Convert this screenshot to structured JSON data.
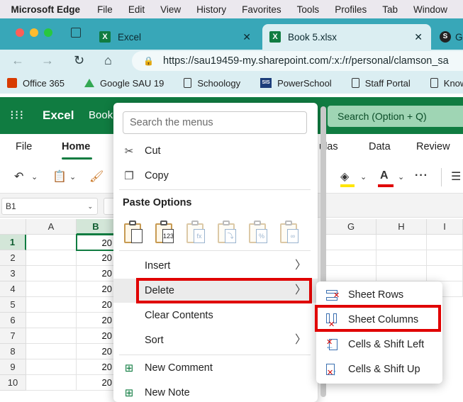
{
  "mac_menubar": {
    "app_name": "Microsoft Edge",
    "items": [
      "File",
      "Edit",
      "View",
      "History",
      "Favorites",
      "Tools",
      "Profiles",
      "Tab",
      "Window"
    ]
  },
  "browser": {
    "tabs": [
      {
        "title": "Excel",
        "close": "✕"
      },
      {
        "title": "Book 5.xlsx",
        "close": "✕"
      }
    ],
    "next_tab_letter": "G",
    "url": "https://sau19459-my.sharepoint.com/:x:/r/personal/clamson_sa",
    "bookmarks": [
      "Office 365",
      "Google SAU 19",
      "Schoology",
      "PowerSchool",
      "Staff Portal",
      "Knowledge B"
    ],
    "sis_label": "SIS"
  },
  "excel": {
    "app_label": "Excel",
    "doc_partial": "Book",
    "search_placeholder": "Search (Option + Q)",
    "ribbon_tabs": {
      "file": "File",
      "home": "Home",
      "formulas_partial": "ulas",
      "data": "Data",
      "review": "Review"
    },
    "name_box": "B1",
    "columns": [
      "A",
      "B",
      "G",
      "H",
      "I"
    ],
    "rows": [
      "1",
      "2",
      "3",
      "4",
      "5",
      "6",
      "7",
      "8",
      "9",
      "10"
    ],
    "b_values": [
      "20",
      "20",
      "20",
      "20",
      "20",
      "20",
      "20",
      "20",
      "20",
      "20"
    ]
  },
  "context_menu": {
    "search_placeholder": "Search the menus",
    "cut": "Cut",
    "copy": "Copy",
    "paste_options": "Paste Options",
    "insert": "Insert",
    "delete": "Delete",
    "clear_contents": "Clear Contents",
    "sort": "Sort",
    "new_comment": "New Comment",
    "new_note": "New Note",
    "chevron": "〉"
  },
  "delete_submenu": {
    "sheet_rows": "Sheet Rows",
    "sheet_columns": "Sheet Columns",
    "cells_shift_left": "Cells & Shift Left",
    "cells_shift_up": "Cells & Shift Up"
  },
  "colors": {
    "excel_green": "#107c41",
    "tab_strip": "#38a7b8",
    "highlight_red": "#e00000"
  }
}
